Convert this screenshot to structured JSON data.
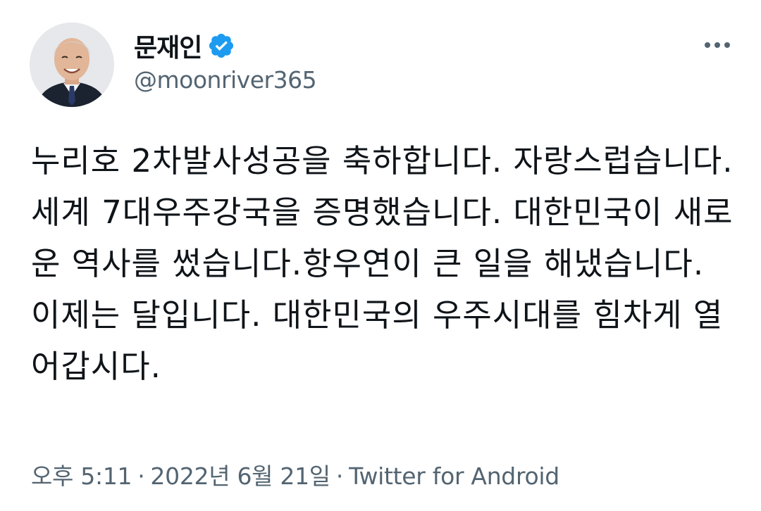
{
  "tweet": {
    "display_name": "문재인",
    "verified": true,
    "handle": "@moonriver365",
    "more_icon": "more-horizontal-icon",
    "text": "누리호 2차발사성공을 축하합니다. 자랑스럽습니다. 세계 7대우주강국을 증명했습니다. 대한민국이 새로운 역사를 썼습니다.항우연이 큰 일을 해냈습니다. 이제는 달입니다. 대한민국의 우주시대를 힘차게 열어갑시다.",
    "time": "오후 5:11",
    "separator": "·",
    "date": "2022년 6월 21일",
    "source": "Twitter for Android"
  },
  "colors": {
    "text": "#0f1419",
    "secondary": "#536471",
    "verified_badge": "#1d9bf0"
  }
}
